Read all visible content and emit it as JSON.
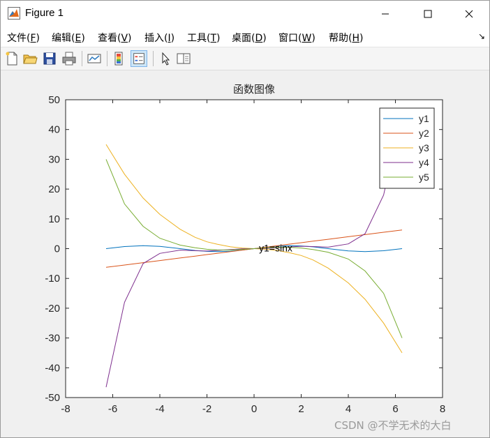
{
  "window": {
    "title": "Figure 1"
  },
  "menu": [
    {
      "label": "文件(F)",
      "underline": "F"
    },
    {
      "label": "编辑(E)",
      "underline": "E"
    },
    {
      "label": "查看(V)",
      "underline": "V"
    },
    {
      "label": "插入(I)",
      "underline": "I"
    },
    {
      "label": "工具(T)",
      "underline": "T"
    },
    {
      "label": "桌面(D)",
      "underline": "D"
    },
    {
      "label": "窗口(W)",
      "underline": "W"
    },
    {
      "label": "帮助(H)",
      "underline": "H"
    }
  ],
  "toolbar": {
    "buttons": [
      "new-figure-icon",
      "open-file-icon",
      "save-icon",
      "print-icon",
      "link-plot-icon",
      "colorbar-icon",
      "legend-icon",
      "pointer-icon",
      "property-editor-icon"
    ],
    "active": "legend-icon"
  },
  "watermark": "CSDN @不学无术的大白",
  "chart_data": {
    "type": "line",
    "title": "函数图像",
    "xlabel": "",
    "ylabel": "",
    "xlim": [
      -8,
      8
    ],
    "ylim": [
      -50,
      50
    ],
    "xticks": [
      -8,
      -6,
      -4,
      -2,
      0,
      2,
      4,
      6,
      8
    ],
    "yticks": [
      -50,
      -40,
      -30,
      -20,
      -10,
      0,
      10,
      20,
      30,
      40,
      50
    ],
    "grid": false,
    "legend_position": "top-right",
    "annotation": {
      "text": "y1=sinx",
      "x": 0,
      "y": 0
    },
    "x": [
      -6.28,
      -5.5,
      -4.71,
      -4,
      -3.14,
      -2.5,
      -2,
      -1.57,
      -1,
      -0.5,
      0,
      0.5,
      1,
      1.57,
      2,
      2.5,
      3.14,
      4,
      4.71,
      5.5,
      6.28
    ],
    "series": [
      {
        "name": "y1",
        "color": "#0072bd",
        "values": [
          0,
          0.7,
          1,
          0.76,
          0,
          -0.6,
          -0.91,
          -1,
          -0.84,
          -0.48,
          0,
          0.48,
          0.84,
          1,
          0.91,
          0.6,
          0,
          -0.76,
          -1,
          -0.7,
          0
        ]
      },
      {
        "name": "y2",
        "color": "#d95319",
        "values": [
          -6.28,
          -5.5,
          -4.71,
          -4,
          -3.14,
          -2.5,
          -2,
          -1.57,
          -1,
          -0.5,
          0,
          0.5,
          1,
          1.57,
          2,
          2.5,
          3.14,
          4,
          4.71,
          5.5,
          6.28
        ]
      },
      {
        "name": "y3",
        "color": "#edb120",
        "values": [
          35,
          25,
          17,
          11.5,
          6.5,
          3.8,
          2.3,
          1.5,
          0.6,
          0.2,
          0,
          -0.2,
          -0.6,
          -1.5,
          -2.3,
          -3.8,
          -6.5,
          -11.5,
          -17,
          -25,
          -35
        ]
      },
      {
        "name": "y4",
        "color": "#7e2f8e",
        "values": [
          -46.5,
          -18,
          -5,
          -1.6,
          -0.5,
          -0.7,
          -0.8,
          -0.6,
          -0.3,
          -0.05,
          0,
          0.05,
          0.3,
          0.6,
          0.8,
          0.7,
          0.5,
          1.6,
          5,
          18,
          46.5
        ]
      },
      {
        "name": "y5",
        "color": "#77ac30",
        "values": [
          30,
          15,
          7.5,
          3.5,
          1.2,
          0.3,
          -0.2,
          -0.4,
          -0.45,
          -0.25,
          0,
          0.25,
          0.45,
          0.4,
          0.2,
          -0.3,
          -1.2,
          -3.5,
          -7.5,
          -15,
          -30
        ]
      }
    ]
  }
}
